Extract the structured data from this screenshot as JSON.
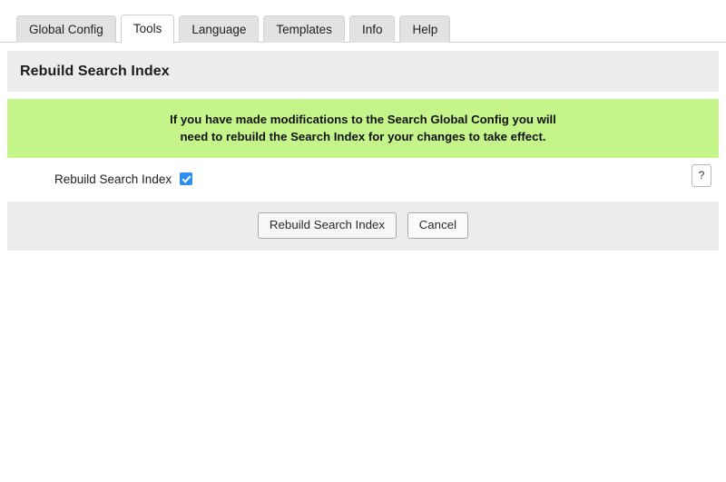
{
  "tabs": [
    {
      "label": "Global Config",
      "active": false
    },
    {
      "label": "Tools",
      "active": true
    },
    {
      "label": "Language",
      "active": false
    },
    {
      "label": "Templates",
      "active": false
    },
    {
      "label": "Info",
      "active": false
    },
    {
      "label": "Help",
      "active": false
    }
  ],
  "panel": {
    "title": "Rebuild Search Index"
  },
  "alert": {
    "line1": "If you have made modifications to the Search Global Config you will",
    "line2": "need to rebuild the Search Index for your changes to take effect.",
    "background": "#c4f48a"
  },
  "form": {
    "field_label": "Rebuild Search Index",
    "checkbox_checked": true,
    "checkbox_color": "#2e8ef0",
    "help_label": "?"
  },
  "footer": {
    "submit_label": "Rebuild Search Index",
    "cancel_label": "Cancel"
  }
}
